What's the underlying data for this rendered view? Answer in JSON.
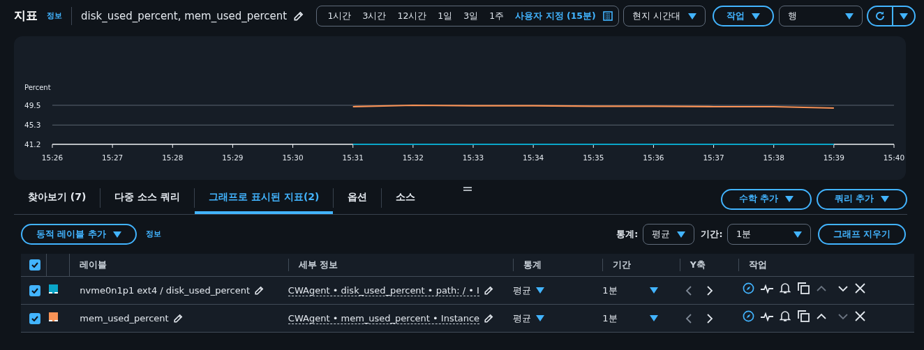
{
  "header": {
    "title": "지표",
    "info_link": "정보",
    "graph_title": "disk_used_percent, mem_used_percent"
  },
  "time_ranges": [
    {
      "label": "1시간",
      "selected": false
    },
    {
      "label": "3시간",
      "selected": false
    },
    {
      "label": "12시간",
      "selected": false
    },
    {
      "label": "1일",
      "selected": false
    },
    {
      "label": "3일",
      "selected": false
    },
    {
      "label": "1주",
      "selected": false
    },
    {
      "label": "사용자 지정 (15분)",
      "selected": true
    }
  ],
  "timezone_select": "현지 시간대",
  "actions_button": "작업",
  "view_select": "행",
  "chart": {
    "chart_data": {
      "type": "line",
      "ylabel": "Percent",
      "categories": [
        "15:26",
        "15:27",
        "15:28",
        "15:29",
        "15:30",
        "15:31",
        "15:32",
        "15:33",
        "15:34",
        "15:35",
        "15:36",
        "15:37",
        "15:38",
        "15:39",
        "15:40"
      ],
      "ylim": [
        41.2,
        49.5
      ],
      "yticks": [
        41.2,
        45.3,
        49.5
      ],
      "series": [
        {
          "color": "#0aa5c8",
          "values": [
            null,
            null,
            null,
            null,
            null,
            41.2,
            41.2,
            41.2,
            41.2,
            41.2,
            41.2,
            41.2,
            41.2,
            41.2,
            null
          ]
        },
        {
          "color": "#f89256",
          "values": [
            null,
            null,
            null,
            null,
            null,
            49.2,
            49.5,
            49.4,
            49.4,
            49.3,
            49.3,
            49.2,
            49.2,
            48.9,
            null
          ]
        }
      ]
    }
  },
  "tabs": [
    {
      "label": "찾아보기 (7)",
      "selected": false
    },
    {
      "label": "다중 소스 쿼리",
      "selected": false
    },
    {
      "label": "그래프로 표시된 지표(2)",
      "selected": true
    },
    {
      "label": "옵션",
      "selected": false
    },
    {
      "label": "소스",
      "selected": false
    }
  ],
  "tab_buttons": [
    "수학 추가",
    "쿼리 추가"
  ],
  "toolbar": {
    "dynamic_label_button": "동적 레이블 추가",
    "info_link": "정보",
    "statistic_label": "통계:",
    "statistic": "평균",
    "period_label": "기간:",
    "period": "1분",
    "clear_button": "그래프 지우기"
  },
  "table": {
    "all_checked": true,
    "columns": [
      "레이블",
      "세부 정보",
      "통계",
      "기간",
      "Y축",
      "작업"
    ],
    "rows": [
      {
        "checked": true,
        "color": "#0aa5c8",
        "label": "nvme0n1p1 ext4 / disk_used_percent",
        "details": "CWAgent • disk_used_percent • path: / • I",
        "statistic": "평균",
        "period": "1분",
        "move_up_disabled": true,
        "move_down_disabled": false
      },
      {
        "checked": true,
        "color": "#f89256",
        "label": "mem_used_percent",
        "details": "CWAgent • mem_used_percent • Instance",
        "statistic": "평균",
        "period": "1분",
        "move_up_disabled": false,
        "move_down_disabled": true
      }
    ]
  }
}
